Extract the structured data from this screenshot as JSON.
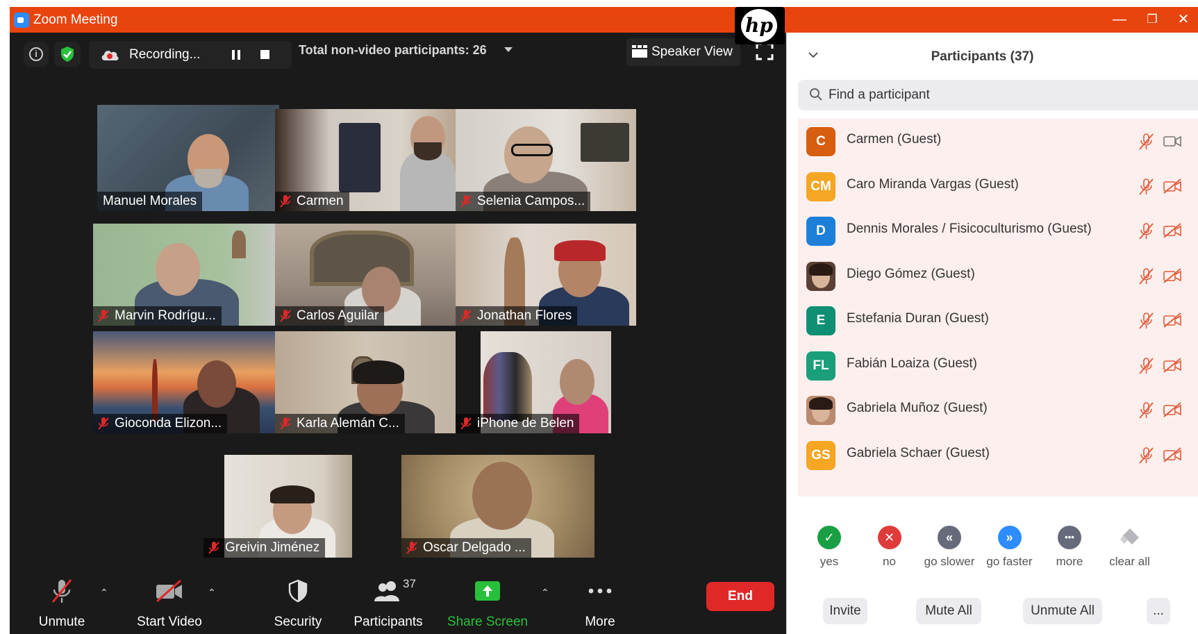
{
  "window": {
    "title": "Zoom Meeting",
    "minimize": "—",
    "restore": "❐",
    "close": "✕",
    "hp_logo": "hp"
  },
  "top_bar": {
    "recording_label": "Recording...",
    "non_video_participants": "Total non-video participants: 26",
    "speaker_view_label": "Speaker View"
  },
  "tiles": [
    {
      "name": "Manuel Morales",
      "muted": false,
      "active": true
    },
    {
      "name": "Carmen",
      "muted": true
    },
    {
      "name": "Selenia Campos...",
      "muted": true
    },
    {
      "name": "Marvin Rodrígu...",
      "muted": true
    },
    {
      "name": "Carlos Aguilar",
      "muted": true
    },
    {
      "name": "Jonathan Flores",
      "muted": true
    },
    {
      "name": "Gioconda Elizon...",
      "muted": true
    },
    {
      "name": "Karla Alemán C...",
      "muted": true
    },
    {
      "name": "iPhone de Belen",
      "muted": true
    },
    {
      "name": "Greivin Jiménez",
      "muted": true
    },
    {
      "name": "Oscar Delgado ...",
      "muted": true
    }
  ],
  "toolbar": {
    "unmute": "Unmute",
    "start_video": "Start Video",
    "security": "Security",
    "participants": "Participants",
    "participants_count": "37",
    "share_screen": "Share Screen",
    "more": "More",
    "end": "End"
  },
  "panel": {
    "title": "Participants (37)",
    "search_placeholder": "Find a participant",
    "participants": [
      {
        "initials": "C",
        "name": "Carmen (Guest)",
        "color": "#d75e0f",
        "photo": false,
        "cam": "on"
      },
      {
        "initials": "CM",
        "name": "Caro Miranda Vargas (Guest)",
        "color": "#f5a623",
        "photo": false,
        "cam": "off"
      },
      {
        "initials": "D",
        "name": "Dennis Morales / Fisicoculturismo (Guest)",
        "color": "#1d7fd8",
        "photo": false,
        "cam": "off"
      },
      {
        "initials": "",
        "name": "Diego Gómez (Guest)",
        "color": "#5a4034",
        "photo": true,
        "cam": "off"
      },
      {
        "initials": "E",
        "name": "Estefania Duran (Guest)",
        "color": "#0f8f73",
        "photo": false,
        "cam": "off"
      },
      {
        "initials": "FL",
        "name": "Fabián Loaiza (Guest)",
        "color": "#1a9f7a",
        "photo": false,
        "cam": "off"
      },
      {
        "initials": "",
        "name": "Gabriela Muñoz (Guest)",
        "color": "#b98a70",
        "photo": true,
        "cam": "off"
      },
      {
        "initials": "GS",
        "name": "Gabriela Schaer (Guest)",
        "color": "#f5a623",
        "photo": false,
        "cam": "off"
      }
    ],
    "reactions": [
      {
        "label": "yes",
        "symbol": "✓",
        "color": "#1a9f45"
      },
      {
        "label": "no",
        "symbol": "✕",
        "color": "#e03b3b"
      },
      {
        "label": "go slower",
        "symbol": "«",
        "color": "#666a7a"
      },
      {
        "label": "go faster",
        "symbol": "»",
        "color": "#2d8cff"
      },
      {
        "label": "more",
        "symbol": "•••",
        "color": "#666a7a"
      },
      {
        "label": "clear all",
        "symbol": "",
        "color": "#9a9aa0"
      }
    ],
    "actions": {
      "invite": "Invite",
      "mute_all": "Mute All",
      "unmute_all": "Unmute All",
      "more": "..."
    }
  }
}
